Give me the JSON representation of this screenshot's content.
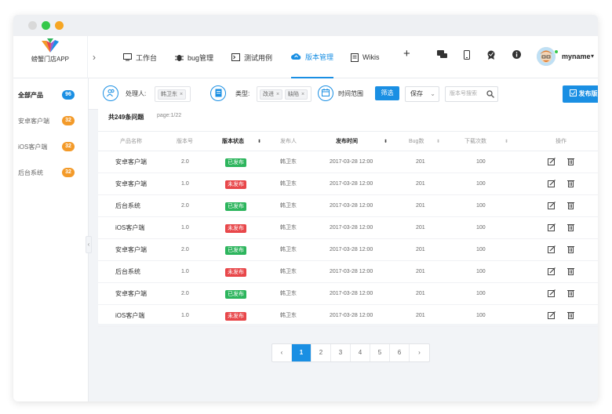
{
  "app": {
    "name": "螃蟹门店APP"
  },
  "nav": {
    "items": [
      {
        "label": "工作台",
        "icon": "monitor-icon"
      },
      {
        "label": "bug管理",
        "icon": "bug-icon"
      },
      {
        "label": "测试用例",
        "icon": "terminal-icon"
      },
      {
        "label": "版本管理",
        "icon": "cloud-upload-icon",
        "active": true
      },
      {
        "label": "Wikis",
        "icon": "book-icon"
      }
    ],
    "add_icon": "plus-icon",
    "right_icons": [
      "chat-icon",
      "mobile-icon",
      "badge-icon",
      "info-icon"
    ],
    "username": "myname"
  },
  "sidebar": {
    "items": [
      {
        "label": "全部产品",
        "count": "96",
        "active": true
      },
      {
        "label": "安卓客户端",
        "count": "32"
      },
      {
        "label": "iOS客户端",
        "count": "32"
      },
      {
        "label": "后台系统",
        "count": "32"
      }
    ]
  },
  "filters": {
    "assignee_label": "处理人:",
    "assignee_tag": "韩卫东",
    "type_label": "类型:",
    "type_tags": [
      "改进",
      "缺陷"
    ],
    "time_label": "时间范围",
    "filter_button": "筛选",
    "save_select": "保存",
    "search_placeholder": "版本号搜索",
    "publish_button": "发布版本"
  },
  "list": {
    "title": "共249条问题",
    "page": "page:1/22",
    "columns": [
      "产品名称",
      "版本号",
      "版本状态",
      "发布人",
      "发布时间",
      "Bug数",
      "下载次数",
      "操作"
    ],
    "rows": [
      {
        "product": "安卓客户端",
        "version": "2.0",
        "status": "已发布",
        "published": true,
        "publisher": "韩卫东",
        "time": "2017-03-28 12:00",
        "bugs": "201",
        "downloads": "100"
      },
      {
        "product": "安卓客户端",
        "version": "1.0",
        "status": "未发布",
        "published": false,
        "publisher": "韩卫东",
        "time": "2017-03-28 12:00",
        "bugs": "201",
        "downloads": "100"
      },
      {
        "product": "后台系统",
        "version": "2.0",
        "status": "已发布",
        "published": true,
        "publisher": "韩卫东",
        "time": "2017-03-28 12:00",
        "bugs": "201",
        "downloads": "100"
      },
      {
        "product": "iOS客户端",
        "version": "1.0",
        "status": "未发布",
        "published": false,
        "publisher": "韩卫东",
        "time": "2017-03-28 12:00",
        "bugs": "201",
        "downloads": "100"
      },
      {
        "product": "安卓客户端",
        "version": "2.0",
        "status": "已发布",
        "published": true,
        "publisher": "韩卫东",
        "time": "2017-03-28 12:00",
        "bugs": "201",
        "downloads": "100"
      },
      {
        "product": "后台系统",
        "version": "1.0",
        "status": "未发布",
        "published": false,
        "publisher": "韩卫东",
        "time": "2017-03-28 12:00",
        "bugs": "201",
        "downloads": "100"
      },
      {
        "product": "安卓客户端",
        "version": "2.0",
        "status": "已发布",
        "published": true,
        "publisher": "韩卫东",
        "time": "2017-03-28 12:00",
        "bugs": "201",
        "downloads": "100"
      },
      {
        "product": "iOS客户端",
        "version": "1.0",
        "status": "未发布",
        "published": false,
        "publisher": "韩卫东",
        "time": "2017-03-28 12:00",
        "bugs": "201",
        "downloads": "100"
      }
    ]
  },
  "pagination": {
    "prev": "‹",
    "pages": [
      "1",
      "2",
      "3",
      "4",
      "5",
      "6"
    ],
    "current": "1",
    "next": "›"
  },
  "colors": {
    "accent": "#1a8fe3",
    "published": "#2db55d",
    "unpublished": "#e8474a",
    "badge_orange": "#f39a29"
  }
}
